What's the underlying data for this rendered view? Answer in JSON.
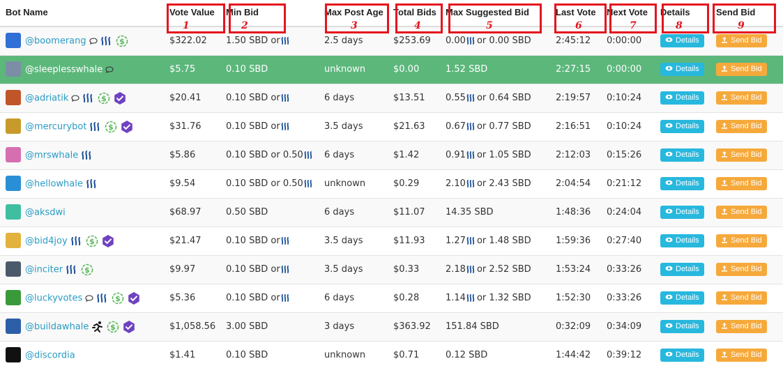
{
  "columns": [
    "Bot Name",
    "Vote Value",
    "Min Bid",
    "Max Post Age",
    "Total Bids",
    "Max Suggested Bid",
    "Last Vote",
    "Next Vote",
    "Details",
    "Send Bid"
  ],
  "annotation_numbers": [
    "1",
    "2",
    "3",
    "4",
    "5",
    "6",
    "7",
    "8",
    "9"
  ],
  "buttons": {
    "details": "Details",
    "send_bid": "Send Bid"
  },
  "colors": {
    "highlight_row": "#5cb77b",
    "details_btn": "#27b8de",
    "send_btn": "#f6a93b",
    "annotation": "#e4141e",
    "link": "#2a9bc4"
  },
  "rows": [
    {
      "name": "@boomerang",
      "avatar_color": "#2f6fd6",
      "icons": [
        "chat",
        "steem",
        "dollar"
      ],
      "vote_value": "$322.02",
      "min_bid": "1.50 SBD or",
      "min_bid_steem": true,
      "max_post_age": "2.5 days",
      "total_bids": "$253.69",
      "max_bid_a": "0.00",
      "max_bid_b": "or 0.00 SBD",
      "last_vote": "2:45:12",
      "next_vote": "0:00:00"
    },
    {
      "name": "@sleeplesswhale",
      "avatar_color": "#7b8ea6",
      "icons": [
        "chat"
      ],
      "vote_value": "$5.75",
      "min_bid": "0.10 SBD",
      "min_bid_steem": false,
      "max_post_age": "unknown",
      "total_bids": "$0.00",
      "max_bid_a": "1.52 SBD",
      "max_bid_b": "",
      "last_vote": "2:27:15",
      "next_vote": "0:00:00",
      "highlight": true
    },
    {
      "name": "@adriatik",
      "avatar_color": "#c0552a",
      "icons": [
        "chat",
        "steem",
        "dollar",
        "verified"
      ],
      "vote_value": "$20.41",
      "min_bid": "0.10 SBD or",
      "min_bid_steem": true,
      "max_post_age": "6 days",
      "total_bids": "$13.51",
      "max_bid_a": "0.55",
      "max_bid_b": "or 0.64 SBD",
      "last_vote": "2:19:57",
      "next_vote": "0:10:24"
    },
    {
      "name": "@mercurybot",
      "avatar_color": "#c79a2b",
      "icons": [
        "steem",
        "dollar",
        "verified"
      ],
      "vote_value": "$31.76",
      "min_bid": "0.10 SBD or",
      "min_bid_steem": true,
      "max_post_age": "3.5 days",
      "total_bids": "$21.63",
      "max_bid_a": "0.67",
      "max_bid_b": "or 0.77 SBD",
      "last_vote": "2:16:51",
      "next_vote": "0:10:24"
    },
    {
      "name": "@mrswhale",
      "avatar_color": "#d66fb0",
      "icons": [
        "steem"
      ],
      "vote_value": "$5.86",
      "min_bid": "0.10 SBD or 0.50",
      "min_bid_steem": true,
      "max_post_age": "6 days",
      "total_bids": "$1.42",
      "max_bid_a": "0.91",
      "max_bid_b": "or 1.05 SBD",
      "last_vote": "2:12:03",
      "next_vote": "0:15:26"
    },
    {
      "name": "@hellowhale",
      "avatar_color": "#2a8fd6",
      "icons": [
        "steem"
      ],
      "vote_value": "$9.54",
      "min_bid": "0.10 SBD or 0.50",
      "min_bid_steem": true,
      "max_post_age": "unknown",
      "total_bids": "$0.29",
      "max_bid_a": "2.10",
      "max_bid_b": "or 2.43 SBD",
      "last_vote": "2:04:54",
      "next_vote": "0:21:12"
    },
    {
      "name": "@aksdwi",
      "avatar_color": "#3fbfa0",
      "icons": [],
      "vote_value": "$68.97",
      "min_bid": "0.50 SBD",
      "min_bid_steem": false,
      "max_post_age": "6 days",
      "total_bids": "$11.07",
      "max_bid_a": "14.35 SBD",
      "max_bid_b": "",
      "last_vote": "1:48:36",
      "next_vote": "0:24:04"
    },
    {
      "name": "@bid4joy",
      "avatar_color": "#e3b23c",
      "icons": [
        "steem",
        "dollar",
        "verified"
      ],
      "vote_value": "$21.47",
      "min_bid": "0.10 SBD or",
      "min_bid_steem": true,
      "max_post_age": "3.5 days",
      "total_bids": "$11.93",
      "max_bid_a": "1.27",
      "max_bid_b": "or 1.48 SBD",
      "last_vote": "1:59:36",
      "next_vote": "0:27:40"
    },
    {
      "name": "@inciter",
      "avatar_color": "#4a5a6a",
      "icons": [
        "steem",
        "dollar"
      ],
      "vote_value": "$9.97",
      "min_bid": "0.10 SBD or",
      "min_bid_steem": true,
      "max_post_age": "3.5 days",
      "total_bids": "$0.33",
      "max_bid_a": "2.18",
      "max_bid_b": "or 2.52 SBD",
      "last_vote": "1:53:24",
      "next_vote": "0:33:26"
    },
    {
      "name": "@luckyvotes",
      "avatar_color": "#3a9a3a",
      "icons": [
        "chat",
        "steem",
        "dollar",
        "verified"
      ],
      "vote_value": "$5.36",
      "min_bid": "0.10 SBD or",
      "min_bid_steem": true,
      "max_post_age": "6 days",
      "total_bids": "$0.28",
      "max_bid_a": "1.14",
      "max_bid_b": "or 1.32 SBD",
      "last_vote": "1:52:30",
      "next_vote": "0:33:26"
    },
    {
      "name": "@buildawhale",
      "avatar_color": "#2d5fa8",
      "icons": [
        "runner",
        "dollar",
        "verified"
      ],
      "vote_value": "$1,058.56",
      "min_bid": "3.00 SBD",
      "min_bid_steem": false,
      "max_post_age": "3 days",
      "total_bids": "$363.92",
      "max_bid_a": "151.84 SBD",
      "max_bid_b": "",
      "last_vote": "0:32:09",
      "next_vote": "0:34:09"
    },
    {
      "name": "@discordia",
      "avatar_color": "#111111",
      "icons": [],
      "vote_value": "$1.41",
      "min_bid": "0.10 SBD",
      "min_bid_steem": false,
      "max_post_age": "unknown",
      "total_bids": "$0.71",
      "max_bid_a": "0.12 SBD",
      "max_bid_b": "",
      "last_vote": "1:44:42",
      "next_vote": "0:39:12"
    }
  ]
}
